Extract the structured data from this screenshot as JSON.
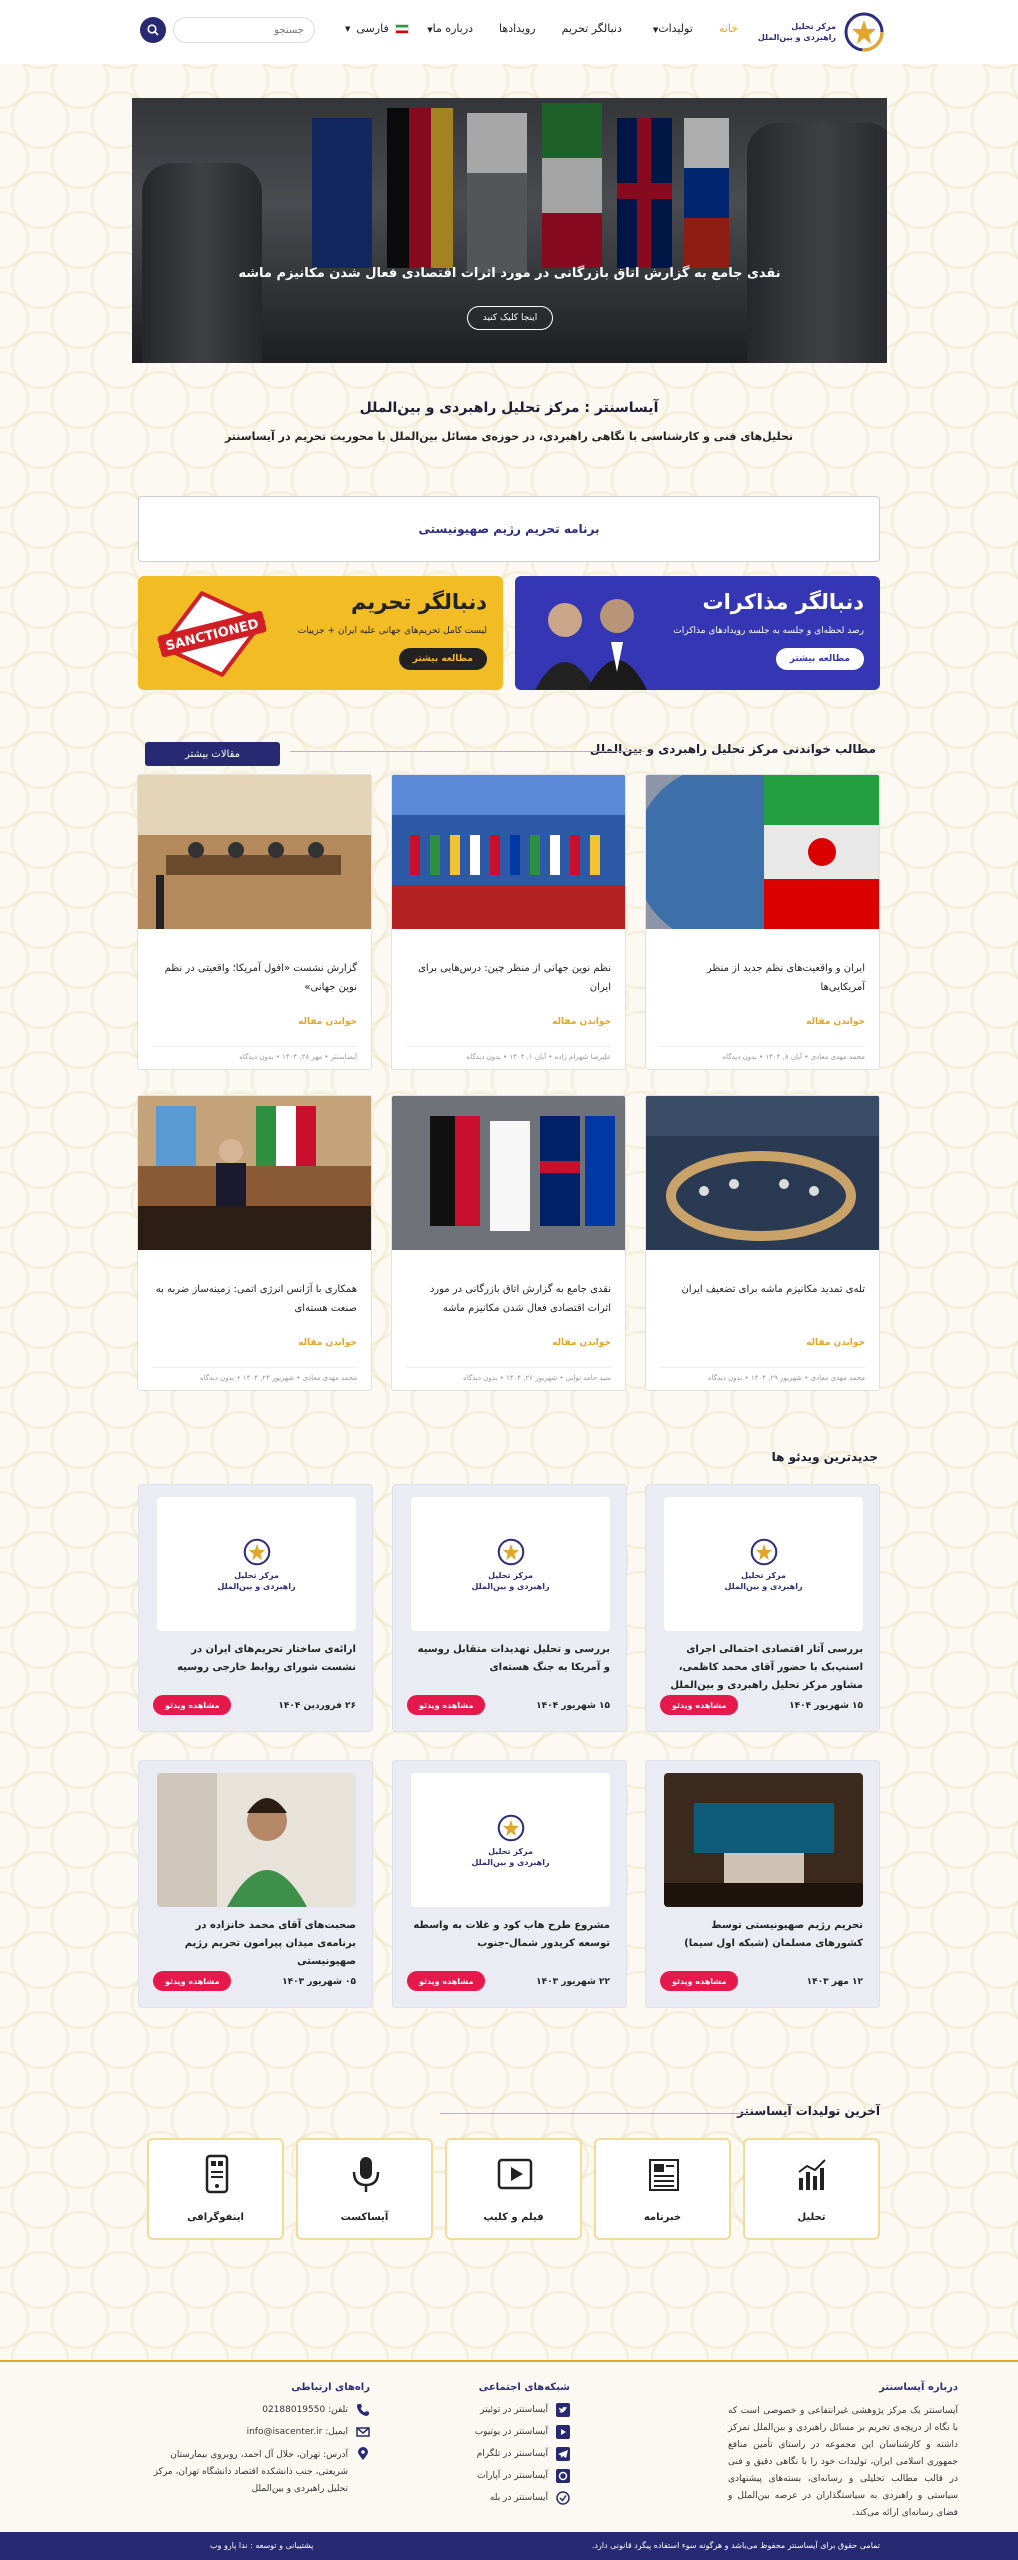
{
  "header": {
    "logo_text": [
      "مرکز تحلیل",
      "راهبردی و بین‌الملل"
    ],
    "nav": [
      {
        "label": "خانه",
        "active": true,
        "dropdown": false
      },
      {
        "label": "تولیدات",
        "active": false,
        "dropdown": true
      },
      {
        "label": "دنبالگر تحریم",
        "active": false,
        "dropdown": false
      },
      {
        "label": "رویدادها",
        "active": false,
        "dropdown": false
      },
      {
        "label": "درباره ما",
        "active": false,
        "dropdown": true
      }
    ],
    "language": "فارسی",
    "search_placeholder": "جستجو"
  },
  "hero": {
    "title": "نقدی جامع به گزارش اتاق بازرگانی در مورد اثرات اقتصادی فعال شدن مکانیزم ماشه",
    "button": "اینجا کلیک کنید"
  },
  "intro": {
    "title": "آیساسنتر : مرکز تحلیل راهبردی و بین‌الملل",
    "subtitle": "تحلیل‌های فنی و کارشناسی با نگاهی راهبردی، در حوزه‌ی مسائل بین‌الملل با محوریت تحریم در آیساسنتر"
  },
  "sanction_program": "برنامه تحریم رژیم صهیونیستی",
  "promos": {
    "negotiations": {
      "title": "دنبالگر مذاکرات",
      "subtitle": "رصد لحظه‌ای و جلسه به جلسه رویدادهای مذاکرات",
      "button": "مطالعه بیشتر"
    },
    "sanctions": {
      "title": "دنبالگر تحریم",
      "subtitle": "لیست کامل تحریم‌های جهانی علیه ایران + جزییات",
      "button": "مطالعه بیشتر",
      "stamp": "SANCTIONED"
    }
  },
  "articles_section": {
    "title": "مطالب خواندنی مرکز تحلیل راهبردی و بین‌الملل",
    "more_button": "مقالات بیشتر",
    "read_label": "خواندن مقاله",
    "items": [
      {
        "title": "ایران و واقعیت‌های نظم جدید از منظر آمریکایی‌ها",
        "meta": "محمد مهدی معادی  •  آبان ۸, ۱۴۰۴  •  بدون دیدگاه"
      },
      {
        "title": "نظم نوین جهانی از منظر چین: درس‌هایی برای ایران",
        "meta": "علیرضا شهرام زاده  •  آبان ۱, ۱۴۰۴  •  بدون دیدگاه"
      },
      {
        "title": "گزارش نشست «افول آمریکا؛ واقعیتی در نظم نوین جهانی»",
        "meta": "آیساسنتر  •  مهر ۲۸, ۱۴۰۴  •  بدون دیدگاه"
      },
      {
        "title": "تله‌ی تمدید مکانیزم ماشه برای تضعیف ایران",
        "meta": "محمد مهدی معادی  •  شهریور ۲۹, ۱۴۰۴  •  بدون دیدگاه"
      },
      {
        "title": "نقدی جامع به گزارش اتاق بازرگانی در مورد اثرات اقتصادی فعال شدن مکانیزم ماشه",
        "meta": "سید حامد نوایی  •  شهریور ۲۶, ۱۴۰۴  •  بدون دیدگاه"
      },
      {
        "title": "همکاری با آژانس انرژی اتمی: زمینه‌ساز ضربه به صنعت هسته‌ای",
        "meta": "محمد مهدی معادی  •  شهریور ۲۴, ۱۴۰۴  •  بدون دیدگاه"
      }
    ]
  },
  "videos_section": {
    "title": "جدیدترین ویدئو ها",
    "watch_label": "مشاهده ویدئو",
    "logo_text": [
      "مرکز تحلیل",
      "راهبردی و بین‌الملل"
    ],
    "items": [
      {
        "title": "بررسی آثار اقتصادی احتمالی اجرای اسنپ‌بک با حضور آقای محمد کاظمی، مشاور مرکز تحلیل راهبردی و بین‌الملل",
        "date": "۱۵ شهریور ۱۴۰۴"
      },
      {
        "title": "بررسی و تحلیل تهدیدات متقابل روسیه و آمریکا به جنگ هسته‌ای",
        "date": "۱۵ شهریور ۱۴۰۴"
      },
      {
        "title": "ارائه‌ی ساختار تحریم‌های ایران در نشست شورای روابط خارجی روسیه",
        "date": "۲۶ فروردین ۱۴۰۴"
      },
      {
        "title": "تحریم رژیم صهیونیستی توسط کشورهای مسلمان (شبکه اول سیما)",
        "date": "۱۲ مهر ۱۴۰۳"
      },
      {
        "title": "مشروع طرح هاب کود و غلات به واسطه توسعه کریدور شمال-جنوب",
        "date": "۲۲ شهریور ۱۴۰۳"
      },
      {
        "title": "صحبت‌های آقای محمد خانزاده در برنامه‌ی میدان پیرامون تحریم رژیم صهیونیستی",
        "date": "۰۵ شهریور ۱۴۰۳"
      }
    ]
  },
  "products_section": {
    "title": "آخرین تولیدات آیساسنتر",
    "items": [
      {
        "label": "تحلیل",
        "icon": "analysis-icon"
      },
      {
        "label": "خبرنامه",
        "icon": "newspaper-icon"
      },
      {
        "label": "فیلم و کلیپ",
        "icon": "video-icon"
      },
      {
        "label": "آیساکست",
        "icon": "microphone-icon"
      },
      {
        "label": "اینفوگرافی",
        "icon": "infographic-icon"
      }
    ]
  },
  "footer": {
    "about": {
      "title": "درباره آیساسنتر",
      "text": "آیساسنتر یک مرکز پژوهشی غیرانتفاعی و خصوصی است که با نگاه از دریچه‌ی تحریم بر مسائل راهبردی و بین‌الملل تمرکز داشته و کارشناسان این مجموعه در راستای تأمین منافع جمهوری اسلامی ایران، تولیدات خود را با نگاهی دقیق و فنی در قالب مطالب تحلیلی و رسانه‌ای، بسته‌های پیشنهادی سیاستی و راهبردی به سیاستگذاران در عرصه بین‌الملل و فضای رسانه‌ای ارائه می‌کند."
    },
    "social": {
      "title": "شبکه‌های اجتماعی",
      "items": [
        "آیساسنتر در توئیتر",
        "آیساسنتر در یوتیوب",
        "آیساسنتر در تلگرام",
        "آیساسنتر در آپارات",
        "آیساسنتر در بله"
      ]
    },
    "contact": {
      "title": "راه‌های ارتباطی",
      "phone": "تلفن: 02188019550",
      "email": "ایمیل: info@isacenter.ir",
      "address": "آدرس: تهران، جلال آل احمد، روبروی بیمارستان شریعتی، جنب دانشکده اقتصاد دانشگاه تهران، مرکز تحلیل راهبردی و بین‌الملل"
    },
    "rights": "تمامی حقوق برای آیساسنتر محفوظ می‌باشد و هرگونه سوء استفاده پیگرد قانونی دارد.",
    "support_prefix": "پشتیبانی و توسعه : ",
    "support_name": "ندا پارو وب"
  },
  "colors": {
    "navy": "#272a72",
    "gold": "#e2a629",
    "negotiations_blue": "#3536b3",
    "sanctions_yellow": "#f2bd24",
    "video_red": "#e6194d"
  }
}
